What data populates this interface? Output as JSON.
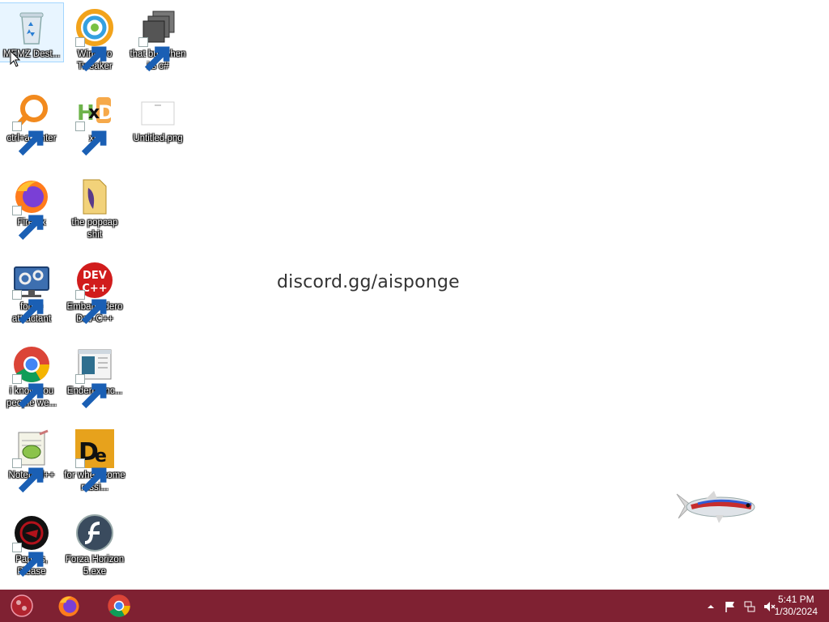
{
  "desktop": {
    "icons": [
      {
        "label": "MEMZ Dest...",
        "icon": "recycle-bin-icon"
      },
      {
        "label": "Winaero Tweaker",
        "icon": "winaero-tweaker-icon"
      },
      {
        "label": "that but when its c#",
        "icon": "stacked-windows-icon"
      },
      {
        "label": "ctrl+a, enter",
        "icon": "magnifier-icon"
      },
      {
        "label": "xD",
        "icon": "hxd-icon"
      },
      {
        "label": "Untitled.png",
        "icon": "image-file-icon"
      },
      {
        "label": "Firefox",
        "icon": "firefox-icon"
      },
      {
        "label": "the popcap shit",
        "icon": "folder-icon"
      },
      {
        "label": "forkie attractant",
        "icon": "computer-settings-icon"
      },
      {
        "label": "Embarcadero Dev-C++",
        "icon": "dev-cpp-icon"
      },
      {
        "label": "i know you people we...",
        "icon": "chrome-icon"
      },
      {
        "label": "Endermanc...",
        "icon": "window-app-icon"
      },
      {
        "label": "Notepad++",
        "icon": "notepad-plus-plus-icon"
      },
      {
        "label": "for when some russi...",
        "icon": "de-icon"
      },
      {
        "label": "Papers, Please",
        "icon": "papers-please-icon"
      },
      {
        "label": "Forza Horizon 5.exe",
        "icon": "flash-icon"
      }
    ],
    "center_text": "discord.gg/aisponge"
  },
  "taskbar": {
    "pinned": [
      "start-orb-icon",
      "firefox-icon",
      "chrome-icon"
    ],
    "tray": [
      "show-hidden-icons-icon",
      "flag-icon",
      "network-icon",
      "volume-muted-icon"
    ],
    "time": "5:41 PM",
    "date": "1/30/2024",
    "color": "#7f2132"
  }
}
